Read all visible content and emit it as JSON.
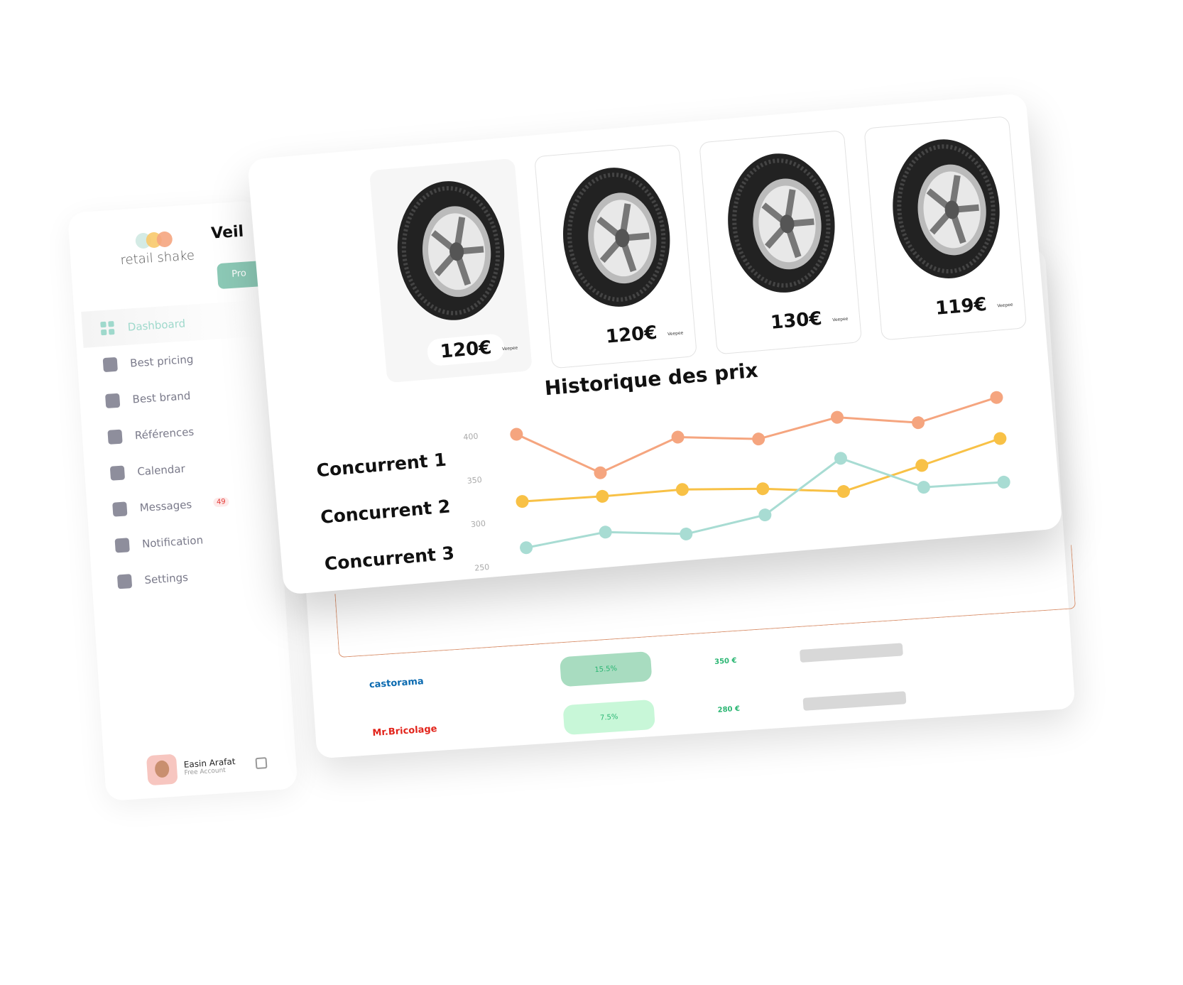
{
  "sidebar": {
    "logo_text": "retail shake",
    "logo_colors": [
      "#cfe9e2",
      "#f8c96a",
      "#f5a57f"
    ],
    "items": [
      {
        "label": "Dashboard",
        "icon": "grid-icon",
        "active": true
      },
      {
        "label": "Best pricing",
        "icon": "chart-icon"
      },
      {
        "label": "Best brand",
        "icon": "brand-icon"
      },
      {
        "label": "Références",
        "icon": "document-icon"
      },
      {
        "label": "Calendar",
        "icon": "calendar-icon"
      },
      {
        "label": "Messages",
        "icon": "messages-icon",
        "badge": "49"
      },
      {
        "label": "Notification",
        "icon": "bell-icon"
      },
      {
        "label": "Settings",
        "icon": "gear-icon"
      }
    ],
    "user": {
      "name": "Easin Arafat",
      "account": "Free Account"
    }
  },
  "main": {
    "title": "Veil",
    "button": "Pro",
    "rows": [
      {
        "brand": "castorama",
        "brand_color": "#0a6ab0",
        "percent": "15.5%",
        "pill_color": "#a8dcc0",
        "price": "350 €"
      },
      {
        "brand": "Mr.Bricolage",
        "brand_color": "#e2231a",
        "percent": "7.5%",
        "pill_color": "#c8f7d8",
        "price": "280 €"
      }
    ]
  },
  "products": [
    {
      "price": "120€",
      "seller": "Veepee"
    },
    {
      "price": "120€",
      "seller": "Veepee"
    },
    {
      "price": "130€",
      "seller": "Veepee"
    },
    {
      "price": "119€",
      "seller": "Veepee"
    }
  ],
  "chart_data": {
    "type": "line",
    "title": "Historique des prix",
    "yticks": [
      400,
      350,
      300,
      250
    ],
    "ylim": [
      250,
      400
    ],
    "grid": false,
    "x": [
      1,
      2,
      3,
      4,
      5,
      6,
      7
    ],
    "series": [
      {
        "name": "Concurrent 1",
        "color": "#f5a57f",
        "values": [
          398,
          346,
          379,
          369,
          386,
          372,
          393
        ]
      },
      {
        "name": "Concurrent 2",
        "color": "#f8c146",
        "values": [
          321,
          319,
          319,
          312,
          301,
          323,
          346
        ]
      },
      {
        "name": "Concurrent 3",
        "color": "#a8dcd3",
        "values": [
          268,
          278,
          268,
          282,
          339,
          298,
          296
        ]
      }
    ]
  }
}
